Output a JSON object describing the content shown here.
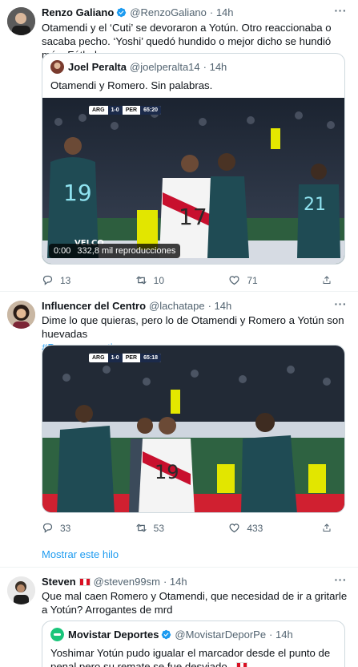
{
  "tweets": [
    {
      "name": "Renzo Galiano",
      "handle": "@RenzoGaliano",
      "time": "· 14h",
      "text": "Otamendi y el ‘Cuti’ se devoraron a Yotún. Otro reaccionaba o sacaba pecho. ‘Yoshi’ quedó hundido o mejor dicho se hundió más. Fútbol.",
      "quote": {
        "name": "Joel Peralta",
        "handle": "@joelperalta14",
        "time": "· 14h",
        "text": "Otamendi y Romero. Sin palabras.",
        "video": {
          "elapsed": "0:00",
          "views": "332,8 mil reproducciones",
          "score": {
            "home": "ARG",
            "result": "1-0",
            "away": "PER",
            "clock": "65:20"
          },
          "watermark": "VELCO"
        }
      },
      "replies": "13",
      "retweets": "10",
      "likes": "71"
    },
    {
      "name": "Influencer del Centro",
      "handle": "@lachatape",
      "time": "· 14h",
      "text": "Dime lo que quieras, pero lo de Otamendi y Romero a Yotún son huevadas",
      "hashtag": "#Peruvsargentina",
      "video": {
        "score": {
          "home": "ARG",
          "result": "1-0",
          "away": "PER",
          "clock": "65:18"
        }
      },
      "replies": "33",
      "retweets": "53",
      "likes": "433",
      "show_thread": "Mostrar este hilo"
    },
    {
      "name": "Steven",
      "handle": "@steven99sm",
      "time": "· 14h",
      "text": "Que mal caen Romero y Otamendi, que necesidad de ir a gritarle a Yotún? Arrogantes de mrd",
      "quote": {
        "name": "Movistar Deportes",
        "handle": "@MovistarDeporPe",
        "time": "· 14h",
        "text": "Yoshimar Yotún pudo igualar el marcador desde el punto de penal pero su remate se fue desviado."
      }
    }
  ],
  "colors": {
    "accent": "#1d9bf0",
    "muted": "#536471",
    "border": "#cfd9de"
  },
  "icons": {
    "verified": "verified-badge-icon",
    "more": "more-dots-icon",
    "reply": "reply-icon",
    "retweet": "retweet-icon",
    "like": "heart-icon",
    "share": "share-icon"
  }
}
